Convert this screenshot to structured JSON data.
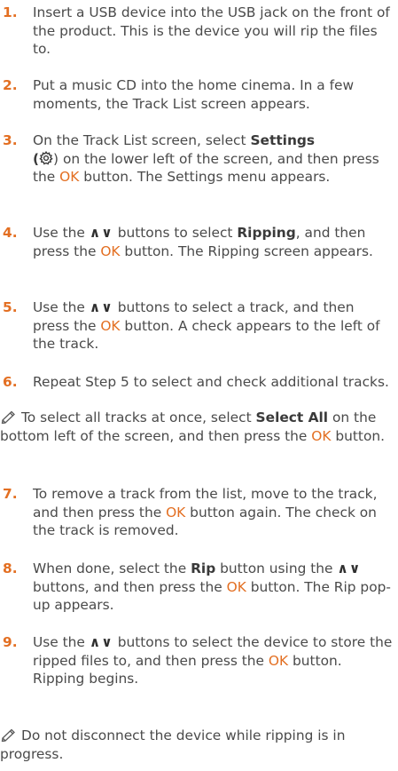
{
  "steps": [
    {
      "num": "1.",
      "parts": [
        "Insert a USB device into the USB jack on the front of the product. This is the device you will rip the files to."
      ]
    },
    {
      "num": "2.",
      "parts": [
        "Put a music CD into the home cinema. In a few moments, the Track List screen appears."
      ]
    },
    {
      "num": "3.",
      "a": "On the Track List screen, select ",
      "b1": "Settings",
      "c": " (",
      "d": ") on the lower left of the screen, and then press the ",
      "ok": "OK",
      "e": " button. The Settings menu appears."
    },
    {
      "num": "4.",
      "a": "Use the ",
      "arrows": "∧∨",
      "b": " buttons to select ",
      "bold": "Ripping",
      "c": ", and then press the ",
      "ok": "OK",
      "d": " button. The Ripping screen appears."
    },
    {
      "num": "5.",
      "a": "Use the ",
      "arrows": "∧∨",
      "b": " buttons to select a track, and then press the ",
      "ok": "OK",
      "c": " button. A check appears to the left of the track."
    },
    {
      "num": "6.",
      "parts": [
        "Repeat Step 5 to select and check additional tracks."
      ]
    },
    {
      "num": "7.",
      "a": "To remove a track from the list, move to the track, and then press the ",
      "ok": "OK",
      "b": " button again. The check on the track is removed."
    },
    {
      "num": "8.",
      "a": "When done, select the ",
      "bold": "Rip",
      "b": " button using the ",
      "arrows": "∧∨",
      "c": " buttons, and then press the ",
      "ok": "OK",
      "d": " button. The Rip pop-up appears."
    },
    {
      "num": "9.",
      "a": "Use the ",
      "arrows": "∧∨",
      "b": " buttons to select the device to store the ripped files to, and then press the ",
      "ok": "OK",
      "c": " button. Ripping begins."
    }
  ],
  "note1": {
    "a": "To select all tracks at once, select ",
    "bold": "Select All",
    "b": " on the bottom left of the screen, and then press the ",
    "ok": "OK",
    "c": " button."
  },
  "note2": {
    "a": "Do not disconnect the device while ripping is in progress."
  }
}
